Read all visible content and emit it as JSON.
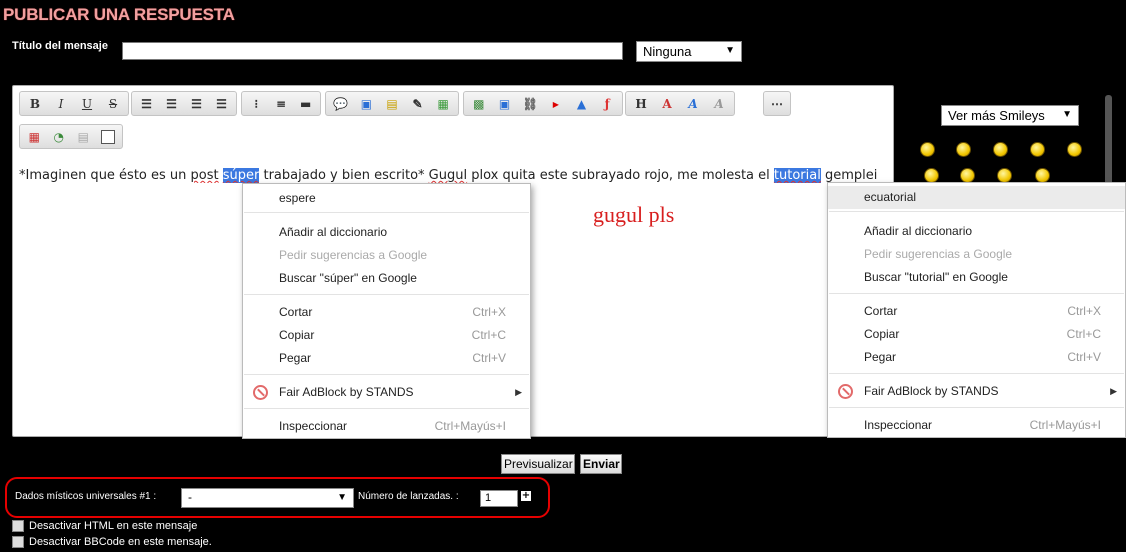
{
  "header": {
    "title": "PUBLICAR UNA RESPUESTA"
  },
  "subject": {
    "label": "Título del mensaje",
    "value": "",
    "icon_select": "Ninguna"
  },
  "toolbar": {
    "row1": [
      [
        "B",
        "I",
        "U",
        "S"
      ],
      [
        "align-left-icon",
        "align-center-icon",
        "align-right-icon",
        "justify-icon"
      ],
      [
        "bullet-list-icon",
        "numbered-list-icon",
        "horizontal-rule-icon"
      ],
      [
        "quote-icon",
        "code-icon",
        "spoiler-icon",
        "edit-note-icon",
        "table-icon"
      ],
      [
        "image-icon",
        "upload-icon",
        "link-icon",
        "youtube-icon",
        "flash-icon",
        "font-icon"
      ],
      [
        "H",
        "color-icon",
        "font-style-icon",
        "clear-format-icon"
      ],
      [
        "more-icon"
      ]
    ],
    "row2": [
      "calendar-icon",
      "clock-icon",
      "paste-icon",
      "source-icon"
    ]
  },
  "editor": {
    "text_before": "*Imaginen que ésto es un ",
    "word_post": "post",
    "word_super": "súper",
    "text_mid": " trabajado y bien escrito* ",
    "word_gugul": "Gugul",
    "text_mid2": " plox quita este subrayado rojo, me molesta el ",
    "word_tutorial": "tutorial",
    "text_after": " gemplei",
    "overlay_note": "gugul pls"
  },
  "context_menu_1": {
    "suggestion": "espere",
    "add_dict": "Añadir al diccionario",
    "ask_google": "Pedir sugerencias a Google",
    "search": "Buscar \"súper\" en Google",
    "cut": "Cortar",
    "cut_sc": "Ctrl+X",
    "copy": "Copiar",
    "copy_sc": "Ctrl+C",
    "paste": "Pegar",
    "paste_sc": "Ctrl+V",
    "ext": "Fair AdBlock by STANDS",
    "inspect": "Inspeccionar",
    "inspect_sc": "Ctrl+Mayús+I"
  },
  "context_menu_2": {
    "suggestion": "ecuatorial",
    "add_dict": "Añadir al diccionario",
    "ask_google": "Pedir sugerencias a Google",
    "search": "Buscar \"tutorial\" en Google",
    "cut": "Cortar",
    "cut_sc": "Ctrl+X",
    "copy": "Copiar",
    "copy_sc": "Ctrl+C",
    "paste": "Pegar",
    "paste_sc": "Ctrl+V",
    "ext": "Fair AdBlock by STANDS",
    "inspect": "Inspeccionar",
    "inspect_sc": "Ctrl+Mayús+I"
  },
  "smileys": {
    "select_label": "Ver más Smileys"
  },
  "actions": {
    "preview": "Previsualizar",
    "send": "Enviar"
  },
  "dice": {
    "label": "Dados místicos universales #1 :",
    "select_value": "-",
    "throws_label": "Número de lanzadas. :",
    "throws_value": "1",
    "plus": "+"
  },
  "options": {
    "disable_html": "Desactivar HTML en este mensaje",
    "disable_bbcode": "Desactivar BBCode en este mensaje."
  },
  "colors": {
    "accent_red": "#e60000",
    "highlight_blue": "#3b78e0",
    "title": "#f0a0a0"
  }
}
